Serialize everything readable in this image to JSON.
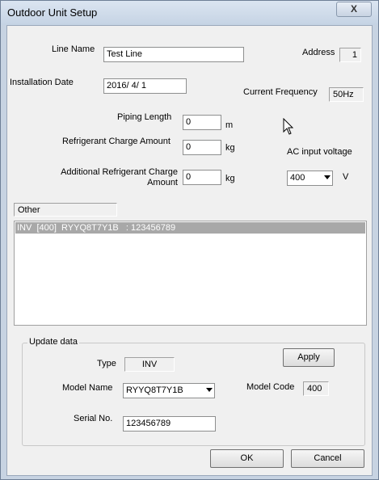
{
  "window": {
    "title": "Outdoor Unit Setup",
    "close_label": "X"
  },
  "fields": {
    "line_name_label": "Line Name",
    "line_name_value": "Test Line",
    "address_label": "Address",
    "address_value": "1",
    "install_date_label": "Installation Date",
    "install_date_value": "2016/ 4/ 1",
    "current_freq_label": "Current Frequency",
    "current_freq_value": "50Hz",
    "piping_length_label": "Piping Length",
    "piping_length_value": "0",
    "piping_length_unit": "m",
    "refrigerant_charge_label": "Refrigerant Charge Amount",
    "refrigerant_charge_value": "0",
    "refrigerant_charge_unit": "kg",
    "additional_charge_label_1": "Additional Refrigerant Charge",
    "additional_charge_label_2": "Amount",
    "additional_charge_value": "0",
    "additional_charge_unit": "kg",
    "ac_input_label": "AC input voltage",
    "ac_input_value": "400",
    "ac_input_unit": "V"
  },
  "other": {
    "label": "Other",
    "items": [
      "INV  [400]  RYYQ8T7Y1B   : 123456789"
    ]
  },
  "update": {
    "group_label": "Update data",
    "type_label": "Type",
    "type_value": "INV",
    "apply_label": "Apply",
    "model_name_label": "Model Name",
    "model_name_value": "RYYQ8T7Y1B",
    "model_code_label": "Model Code",
    "model_code_value": "400",
    "serial_label": "Serial No.",
    "serial_value": "123456789"
  },
  "footer": {
    "ok_label": "OK",
    "cancel_label": "Cancel"
  }
}
